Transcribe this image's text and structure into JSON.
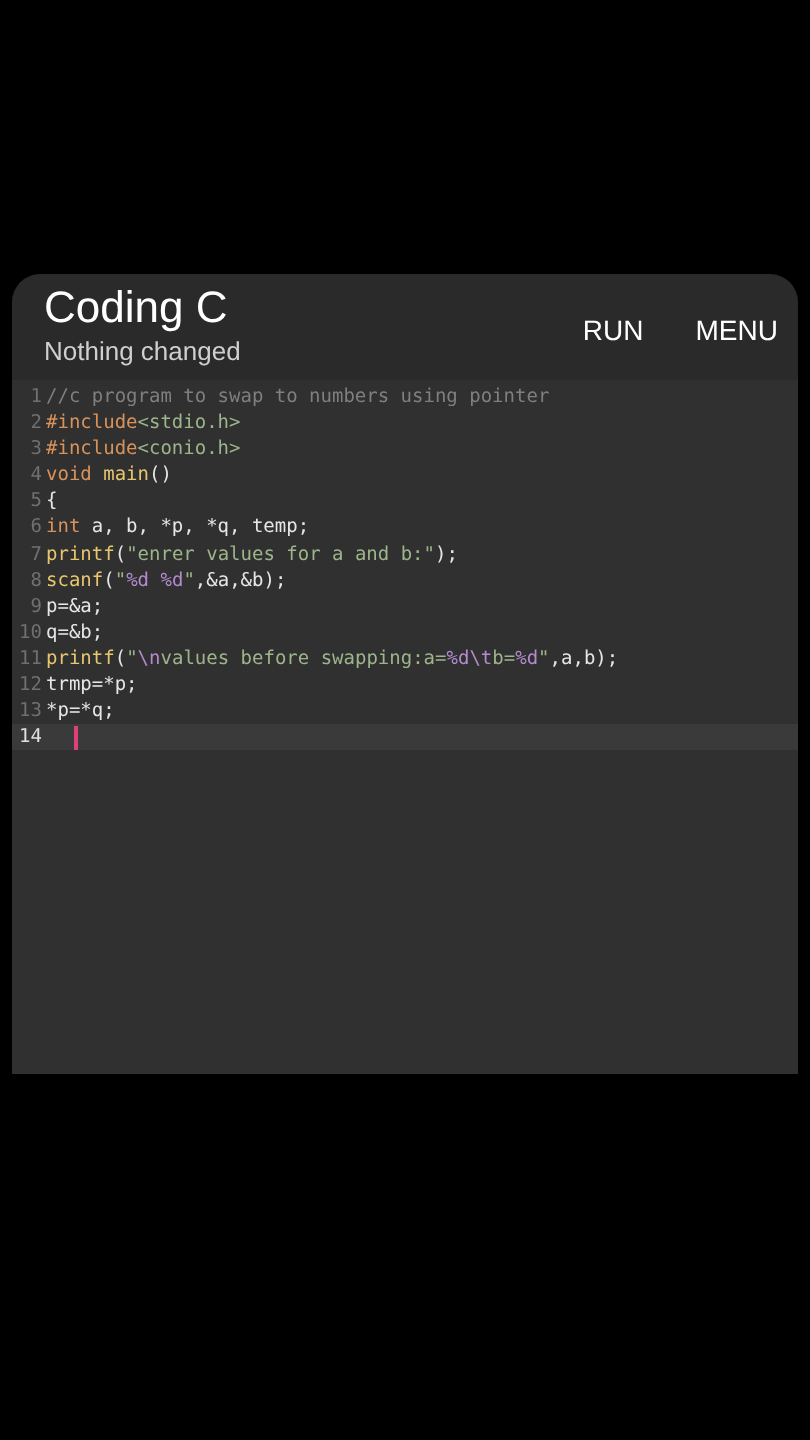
{
  "app_bar": {
    "title": "Coding C",
    "subtitle": "Nothing changed",
    "actions": [
      "RUN",
      "MENU"
    ]
  },
  "editor": {
    "lines": [
      {
        "number": "1",
        "current": false,
        "tokens": [
          {
            "kind": "comment",
            "text": "//c program to swap to numbers using pointer"
          }
        ]
      },
      {
        "number": "2",
        "current": false,
        "tokens": [
          {
            "kind": "keyword",
            "text": "#include"
          },
          {
            "kind": "string",
            "text": "<stdio.h>"
          }
        ]
      },
      {
        "number": "3",
        "current": false,
        "tokens": [
          {
            "kind": "keyword",
            "text": "#include"
          },
          {
            "kind": "string",
            "text": "<conio.h>"
          }
        ]
      },
      {
        "number": "4",
        "current": false,
        "tokens": [
          {
            "kind": "keyword",
            "text": "void"
          },
          {
            "kind": "function",
            "text": " main"
          },
          {
            "kind": "plain",
            "text": "()"
          }
        ]
      },
      {
        "number": "5",
        "current": false,
        "tokens": [
          {
            "kind": "plain",
            "text": "{"
          }
        ]
      },
      {
        "number": "6",
        "current": false,
        "tokens": [
          {
            "kind": "keyword",
            "text": "int"
          },
          {
            "kind": "plain",
            "text": " a, b, *p, *q, temp;"
          }
        ]
      },
      {
        "number": "7",
        "current": false,
        "tokens": [
          {
            "kind": "function",
            "text": "printf"
          },
          {
            "kind": "plain",
            "text": "("
          },
          {
            "kind": "string",
            "text": "\"enrer values for a and b:\""
          },
          {
            "kind": "plain",
            "text": ");"
          }
        ]
      },
      {
        "number": "8",
        "current": false,
        "tokens": [
          {
            "kind": "function",
            "text": "scanf"
          },
          {
            "kind": "plain",
            "text": "("
          },
          {
            "kind": "string",
            "text": "\""
          },
          {
            "kind": "format",
            "text": "%d %d"
          },
          {
            "kind": "string",
            "text": "\""
          },
          {
            "kind": "plain",
            "text": ",&a,&b);"
          }
        ]
      },
      {
        "number": "9",
        "current": false,
        "tokens": [
          {
            "kind": "plain",
            "text": "p=&a;"
          }
        ]
      },
      {
        "number": "10",
        "current": false,
        "tokens": [
          {
            "kind": "plain",
            "text": "q=&b;"
          }
        ]
      },
      {
        "number": "11",
        "current": false,
        "tokens": [
          {
            "kind": "function",
            "text": "printf"
          },
          {
            "kind": "plain",
            "text": "("
          },
          {
            "kind": "string",
            "text": "\""
          },
          {
            "kind": "format",
            "text": "\\n"
          },
          {
            "kind": "string",
            "text": "values before swapping:a="
          },
          {
            "kind": "format",
            "text": "%d\\t"
          },
          {
            "kind": "string",
            "text": "b="
          },
          {
            "kind": "format",
            "text": "%d"
          },
          {
            "kind": "string",
            "text": "\""
          },
          {
            "kind": "plain",
            "text": ",a,b);"
          }
        ]
      },
      {
        "number": "12",
        "current": false,
        "tokens": [
          {
            "kind": "plain",
            "text": "trmp=*p;"
          }
        ]
      },
      {
        "number": "13",
        "current": false,
        "tokens": [
          {
            "kind": "plain",
            "text": "*p=*q;"
          }
        ]
      },
      {
        "number": "14",
        "current": true
      }
    ]
  }
}
